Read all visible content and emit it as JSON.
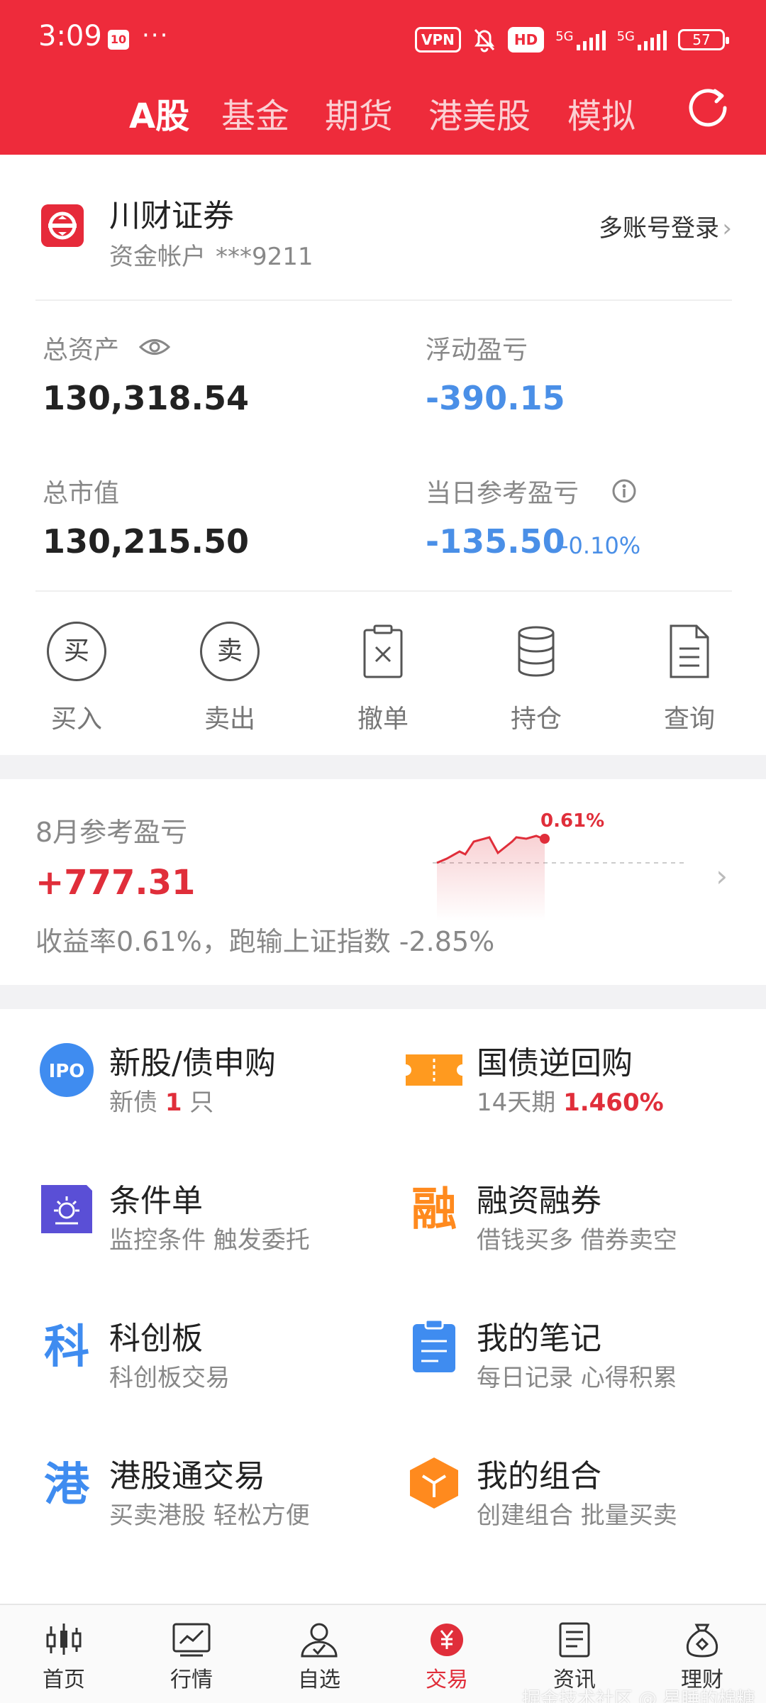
{
  "status_bar": {
    "time": "3:09",
    "app_icon_text": "10",
    "dots": "···",
    "vpn": "VPN",
    "hd": "HD",
    "net1": "5G",
    "net2": "5G",
    "battery": "57"
  },
  "tabs": [
    {
      "label": "A股",
      "active": true
    },
    {
      "label": "基金"
    },
    {
      "label": "期货"
    },
    {
      "label": "港美股"
    },
    {
      "label": "模拟"
    }
  ],
  "account": {
    "broker_name": "川财证券",
    "account_label": "资金帐户",
    "account_number": "***9211",
    "multi_login": "多账号登录"
  },
  "stats": {
    "total_assets_label": "总资产",
    "total_assets": "130,318.54",
    "floating_pl_label": "浮动盈亏",
    "floating_pl": "-390.15",
    "market_value_label": "总市值",
    "market_value": "130,215.50",
    "daily_pl_label": "当日参考盈亏",
    "daily_pl": "-135.50",
    "daily_pl_pct": "-0.10%"
  },
  "actions": [
    {
      "label": "买入",
      "glyph": "买"
    },
    {
      "label": "卖出",
      "glyph": "卖"
    },
    {
      "label": "撤单"
    },
    {
      "label": "持仓"
    },
    {
      "label": "查询"
    }
  ],
  "profit": {
    "title": "8月参考盈亏",
    "value": "+777.31",
    "description": "收益率0.61%，跑输上证指数 -2.85%",
    "spark_pct": "0.61%"
  },
  "functions": [
    {
      "title": "新股/债申购",
      "sub_prefix": "新债 ",
      "sub_value": "1",
      "sub_suffix": " 只",
      "icon_text": "IPO",
      "icon_color": "#3f8cf0"
    },
    {
      "title": "国债逆回购",
      "sub_prefix": "14天期 ",
      "sub_value": "1.460%",
      "sub_suffix": "",
      "icon_color": "#ff9a1f"
    },
    {
      "title": "条件单",
      "sub": "监控条件 触发委托",
      "icon_color": "#5a4fd6"
    },
    {
      "title": "融资融券",
      "sub": "借钱买多 借券卖空",
      "icon_text": "融",
      "icon_color": "#ff8a1e"
    },
    {
      "title": "科创板",
      "sub": "科创板交易",
      "icon_text": "科",
      "icon_color": "#3f8cf0"
    },
    {
      "title": "我的笔记",
      "sub": "每日记录 心得积累",
      "icon_color": "#3f8cf0"
    },
    {
      "title": "港股通交易",
      "sub": "买卖港股 轻松方便",
      "icon_text": "港",
      "icon_color": "#3f8cf0"
    },
    {
      "title": "我的组合",
      "sub": "创建组合 批量买卖",
      "icon_color": "#ff8a1e"
    }
  ],
  "bottom_nav": [
    {
      "label": "首页"
    },
    {
      "label": "行情"
    },
    {
      "label": "自选"
    },
    {
      "label": "交易",
      "active": true
    },
    {
      "label": "资讯"
    },
    {
      "label": "理财"
    }
  ],
  "watermark": "掘金技术社区 @ 星睡的棉糖"
}
